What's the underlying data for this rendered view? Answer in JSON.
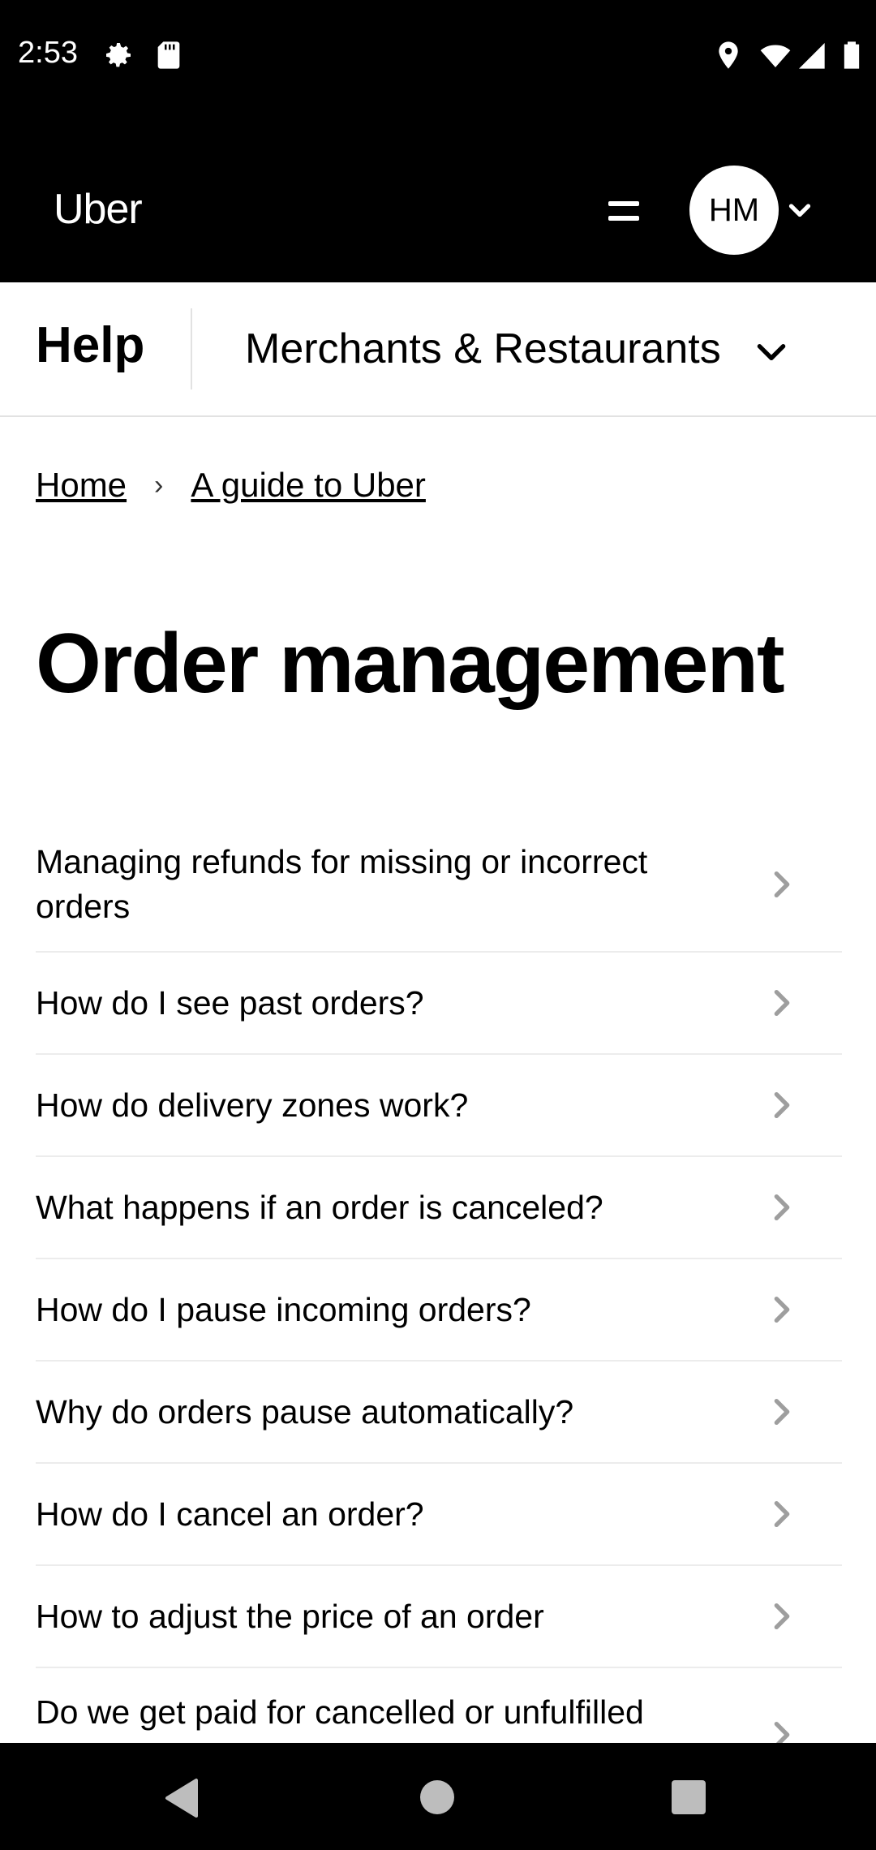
{
  "status_bar": {
    "time": "2:53",
    "icons": [
      "settings-icon",
      "sd-card-icon",
      "location-icon",
      "wifi-icon",
      "signal-icon",
      "battery-icon"
    ]
  },
  "header": {
    "logo": "Uber",
    "avatar_initials": "HM"
  },
  "subnav": {
    "help_label": "Help",
    "category": "Merchants & Restaurants"
  },
  "breadcrumb": {
    "home": "Home",
    "separator": "›",
    "current": "A guide to Uber"
  },
  "page": {
    "title": "Order management"
  },
  "articles": [
    "Managing refunds for missing or incorrect orders",
    "How do I see past orders?",
    "How do delivery zones work?",
    "What happens if an order is canceled?",
    "How do I pause incoming orders?",
    "Why do orders pause automatically?",
    "How do I cancel an order?",
    "How to adjust the price of an order",
    "Do we get paid for cancelled or unfulfilled orders?"
  ],
  "colors": {
    "header_bg": "#000000",
    "text": "#000000",
    "divider": "#ececec",
    "chevron": "#9e9e9e"
  }
}
